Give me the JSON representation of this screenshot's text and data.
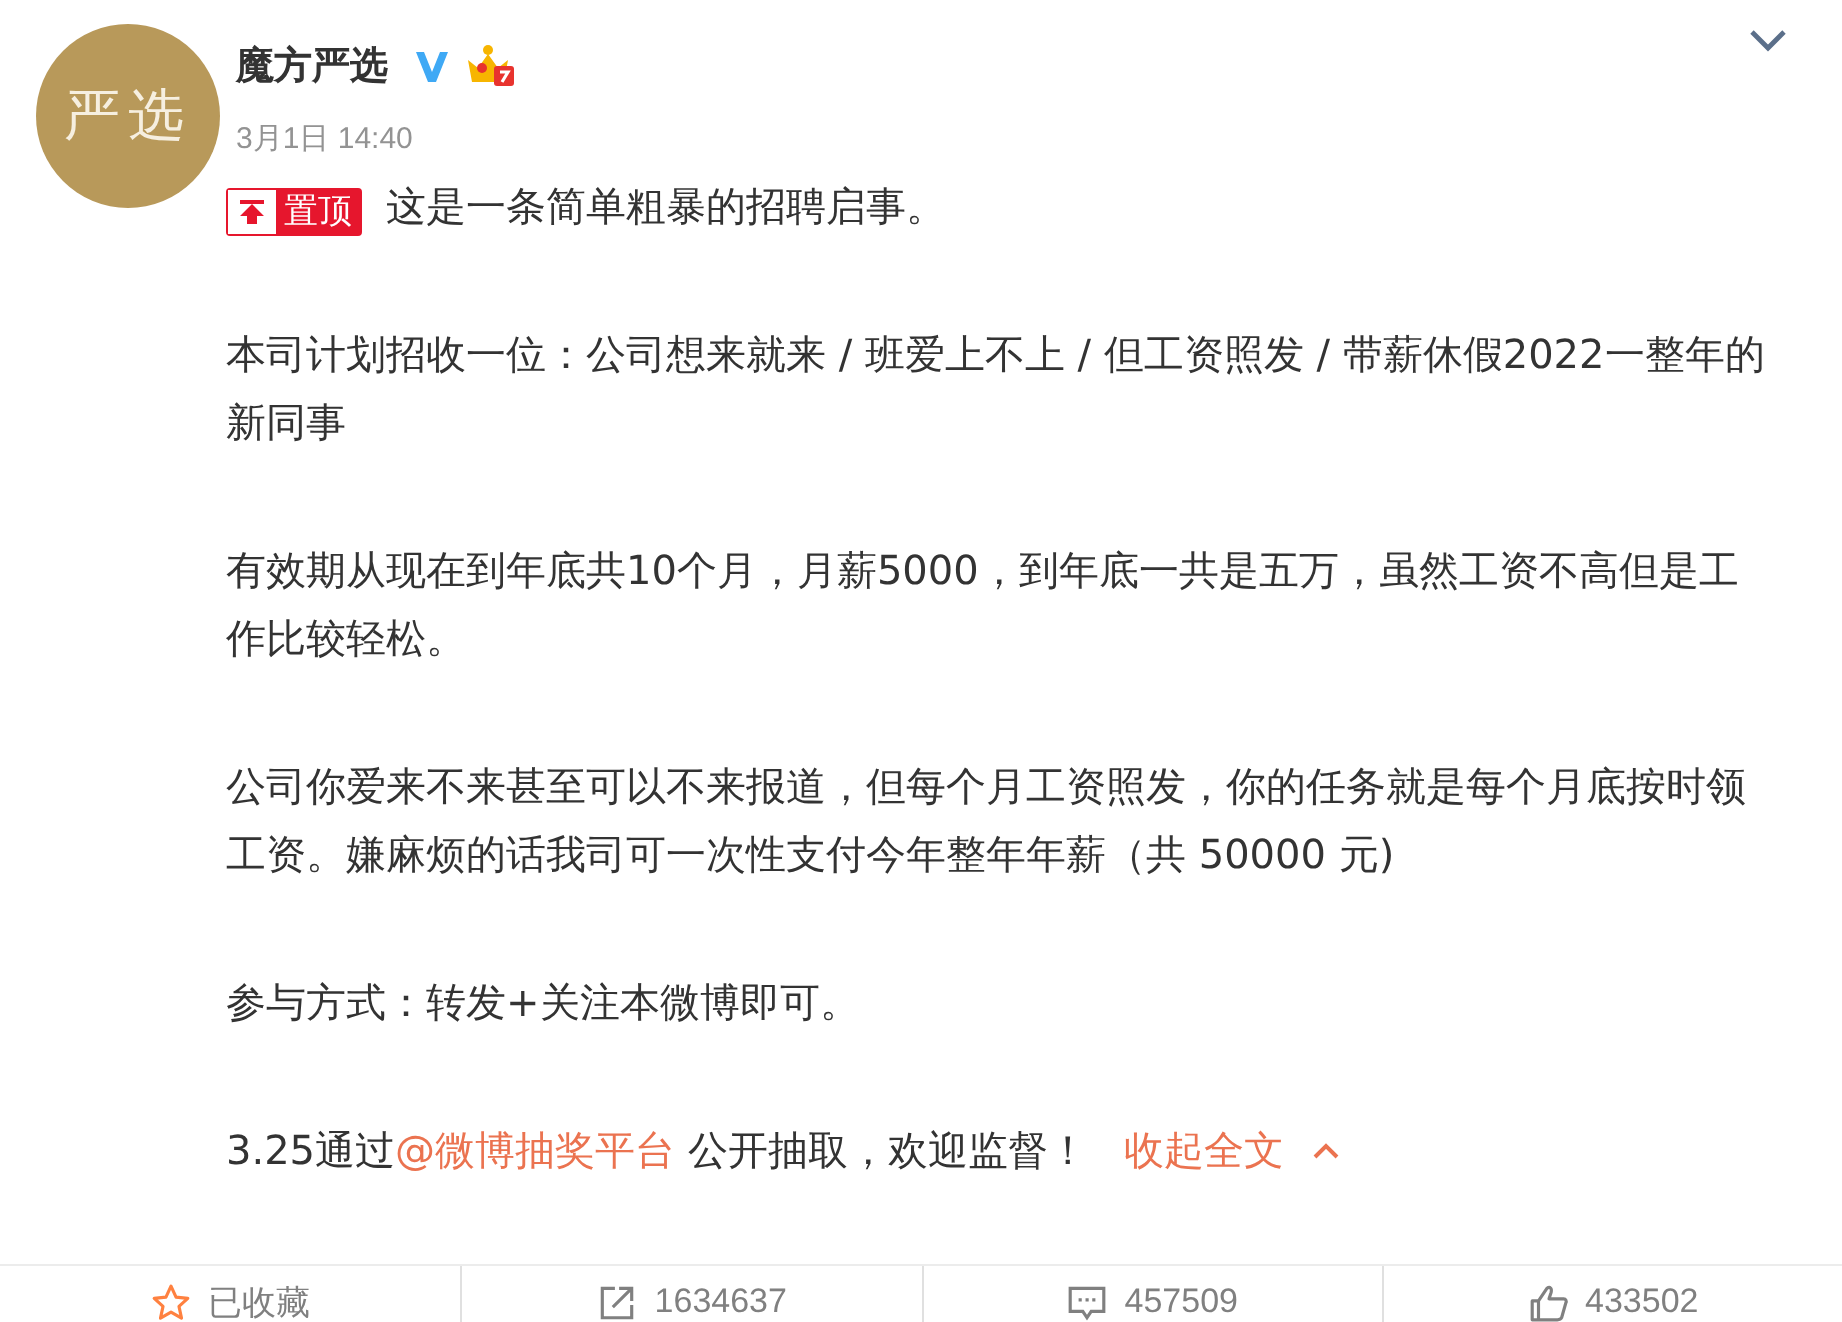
{
  "post": {
    "author": {
      "name": "魔方严选",
      "avatar_text": "严选",
      "verified": true,
      "member": true
    },
    "time": "3月1日 14:40",
    "pinned": {
      "label": "置顶"
    },
    "paragraphs": [
      {
        "parts": [
          {
            "kind": "text",
            "text": "这是一条简单粗暴的招聘启事。"
          }
        ]
      },
      {
        "parts": [
          {
            "kind": "text",
            "text": "本司计划招收一位：公司想来就来 / 班爱上不上 / 但工资照发 / 带薪休假2022一整年的新同事"
          }
        ]
      },
      {
        "parts": [
          {
            "kind": "text",
            "text": "有效期从现在到年底共10个月，月薪5000，到年底一共是五万，虽然工资不高但是工作比较轻松。"
          }
        ]
      },
      {
        "parts": [
          {
            "kind": "text",
            "text": "公司你爱来不来甚至可以不来报道，但每个月工资照发，你的任务就是每个月底按时领工资。嫌麻烦的话我司可一次性支付今年整年年薪（共 50000 元)"
          }
        ]
      },
      {
        "parts": [
          {
            "kind": "text",
            "text": "参与方式：转发+关注本微博即可。"
          }
        ]
      },
      {
        "parts": [
          {
            "kind": "text",
            "text": "3.25通过"
          },
          {
            "kind": "link",
            "text": "@微博抽奖平台"
          },
          {
            "kind": "text",
            "text": " 公开抽取，欢迎监督！"
          }
        ]
      }
    ],
    "collapse": "收起全文"
  },
  "actions": [
    {
      "kind": "favorite",
      "label": "已收藏",
      "on": true
    },
    {
      "kind": "repost",
      "label": "1634637"
    },
    {
      "kind": "comment",
      "label": "457509"
    },
    {
      "kind": "like",
      "label": "433502",
      "on": false
    }
  ]
}
